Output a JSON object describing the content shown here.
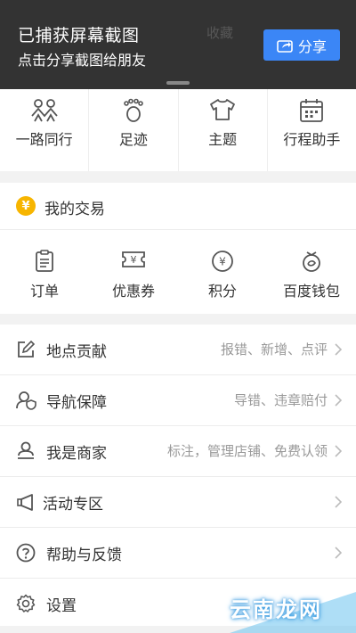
{
  "banner": {
    "title": "已捕获屏幕截图",
    "subtitle": "点击分享截图给朋友",
    "share_label": "分享",
    "ghost_labels": [
      "收藏"
    ]
  },
  "quick_nav": [
    {
      "label": "一路同行",
      "icon": "people-together-icon"
    },
    {
      "label": "足迹",
      "icon": "footprint-icon"
    },
    {
      "label": "主题",
      "icon": "shirt-icon"
    },
    {
      "label": "行程助手",
      "icon": "calendar-icon"
    }
  ],
  "trade": {
    "title": "我的交易",
    "badge_glyph": "¥",
    "items": [
      {
        "label": "订单",
        "icon": "order-icon"
      },
      {
        "label": "优惠券",
        "icon": "coupon-icon"
      },
      {
        "label": "积分",
        "icon": "points-icon"
      },
      {
        "label": "百度钱包",
        "icon": "wallet-icon"
      }
    ]
  },
  "menu": [
    {
      "title": "地点贡献",
      "sub": "报错、新增、点评",
      "icon": "edit-icon"
    },
    {
      "title": "导航保障",
      "sub": "导错、违章赔付",
      "icon": "shield-user-icon"
    },
    {
      "title": "我是商家",
      "sub": "标注，管理店铺、免费认领",
      "icon": "merchant-icon"
    },
    {
      "title": "活动专区",
      "sub": "",
      "icon": "megaphone-icon"
    },
    {
      "title": "帮助与反馈",
      "sub": "",
      "icon": "help-icon"
    },
    {
      "title": "设置",
      "sub": "",
      "icon": "gear-icon"
    }
  ],
  "watermark": {
    "text": "云南龙网"
  },
  "colors": {
    "accent": "#3b86f6",
    "badge": "#f7b500",
    "banner_bg": "#333333"
  }
}
